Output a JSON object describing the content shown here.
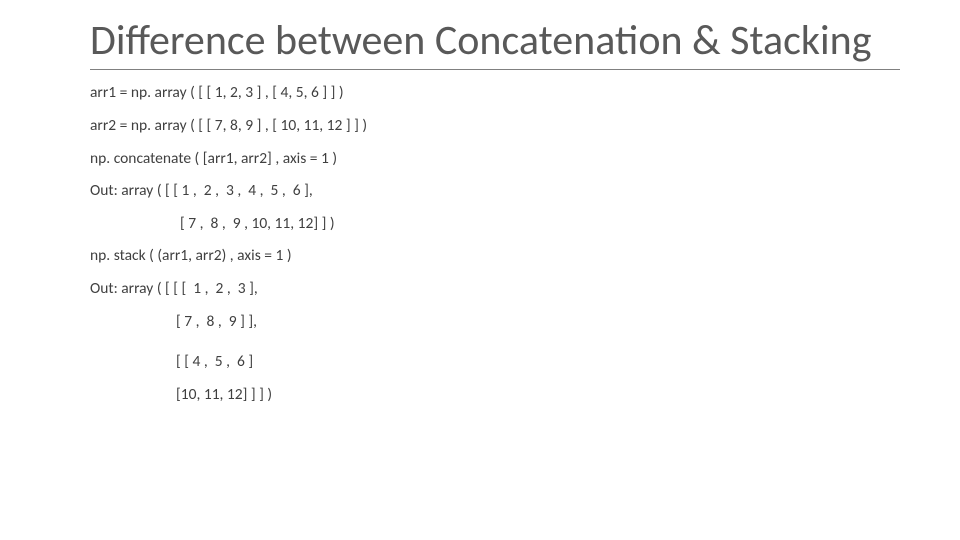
{
  "title": "Difference between Concatenation & Stacking",
  "lines": {
    "l1": "arr1 = np. array ( [ [ 1, 2, 3 ] , [ 4, 5, 6 ] ] )",
    "l2": "arr2 = np. array ( [ [ 7, 8, 9 ] , [ 10, 11, 12 ] ] )",
    "l3": "np. concatenate ( [arr1, arr2] , axis = 1 )",
    "l4": "Out: array ( [ [ 1 ,  2 ,  3 ,  4 ,  5 ,  6 ],",
    "l5": "[ 7 ,  8 ,  9 , 10, 11, 12] ] )",
    "l6": "np. stack ( (arr1, arr2) , axis = 1 )",
    "l7": "Out: array ( [ [ [  1 ,  2 ,  3 ],",
    "l8": "[ 7 ,  8 ,  9 ] ],",
    "l9": "[ [ 4 ,  5 ,  6 ]",
    "l10": "[10, 11, 12] ] ] )"
  },
  "chart_data": {
    "type": "table",
    "arr1": [
      [
        1,
        2,
        3
      ],
      [
        4,
        5,
        6
      ]
    ],
    "arr2": [
      [
        7,
        8,
        9
      ],
      [
        10,
        11,
        12
      ]
    ],
    "concatenate_axis1": [
      [
        1,
        2,
        3,
        4,
        5,
        6
      ],
      [
        7,
        8,
        9,
        10,
        11,
        12
      ]
    ],
    "stack_axis1": [
      [
        [
          1,
          2,
          3
        ],
        [
          7,
          8,
          9
        ]
      ],
      [
        [
          4,
          5,
          6
        ],
        [
          10,
          11,
          12
        ]
      ]
    ]
  }
}
